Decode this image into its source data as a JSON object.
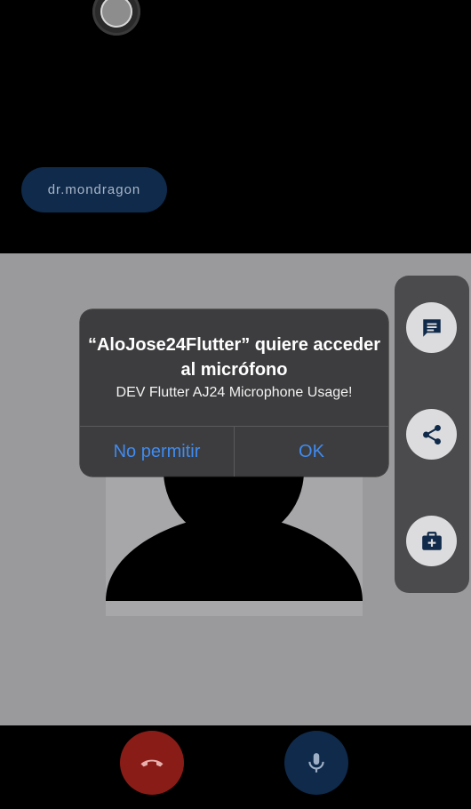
{
  "participant": {
    "name": "dr.mondragon"
  },
  "permission_alert": {
    "title": "“AloJose24Flutter” quiere acceder al micrófono",
    "message": "DEV Flutter AJ24 Microphone Usage!",
    "deny_label": "No permitir",
    "ok_label": "OK",
    "accent_color": "#3f8bf0"
  },
  "side_actions": [
    {
      "icon": "chat-icon"
    },
    {
      "icon": "share-icon"
    },
    {
      "icon": "medical-kit-icon"
    }
  ],
  "call_controls": {
    "end_call_icon": "phone-hangup-icon",
    "end_call_color": "#8a1c17",
    "mic_icon": "microphone-icon",
    "mic_color": "#0f2a4a"
  }
}
